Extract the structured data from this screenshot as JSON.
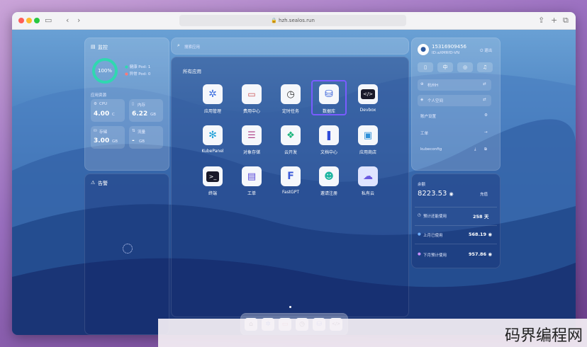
{
  "browser": {
    "url": "hzh.sealos.run"
  },
  "monitor": {
    "title": "监控",
    "percent": "100%",
    "legend_healthy": "健康 Pod: 1",
    "legend_abnormal": "异常 Pod: 0",
    "usage_title": "应用资源",
    "stats": [
      {
        "label": "CPU",
        "value": "4.00",
        "unit": "C"
      },
      {
        "label": "内存",
        "value": "6.22",
        "unit": "GB"
      },
      {
        "label": "存储",
        "value": "3.00",
        "unit": "GB"
      },
      {
        "label": "流量",
        "value": "-",
        "unit": "GB"
      }
    ]
  },
  "alerts": {
    "title": "告警"
  },
  "search": {
    "placeholder": "搜索应用"
  },
  "apps": {
    "title": "所有应用",
    "items": [
      {
        "name": "应用管理"
      },
      {
        "name": "费用中心"
      },
      {
        "name": "定时任务"
      },
      {
        "name": "数据库"
      },
      {
        "name": "Devbox"
      },
      {
        "name": "KubePanel"
      },
      {
        "name": "对象存储"
      },
      {
        "name": "云开发"
      },
      {
        "name": "文档中心"
      },
      {
        "name": "应用商店"
      },
      {
        "name": "终端"
      },
      {
        "name": "工单"
      },
      {
        "name": "FastGPT"
      },
      {
        "name": "邀请注册"
      },
      {
        "name": "私有云"
      }
    ]
  },
  "user": {
    "phone": "15316909456",
    "id": "ID:aXMRfD-VN",
    "logout": "退出",
    "buttons": [
      "CN",
      "中",
      "GH",
      "通知"
    ],
    "region": "杭州H",
    "workspace": "个人空间",
    "menu": [
      {
        "label": "账户设置"
      },
      {
        "label": "工单"
      },
      {
        "label": "kubeconfig"
      }
    ]
  },
  "balance": {
    "label": "余额",
    "value": "8223.53",
    "recharge": "充值",
    "rows": [
      {
        "label": "预计还能使用",
        "value": "258 天"
      },
      {
        "label": "上月已使用",
        "value": "568.19"
      },
      {
        "label": "下月预计使用",
        "value": "957.86"
      }
    ]
  },
  "watermark": "码界编程网",
  "colors": {
    "accent": "#2fd8b0",
    "highlight": "#7a5cff"
  }
}
